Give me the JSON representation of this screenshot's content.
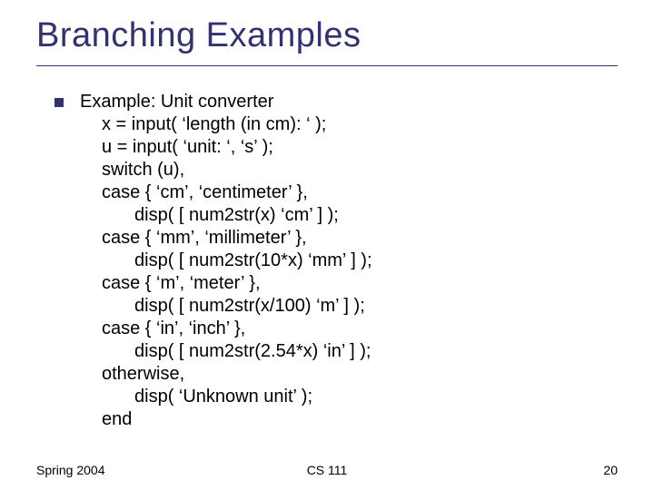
{
  "title": "Branching Examples",
  "bullet_label": "Example: Unit converter",
  "code": {
    "l01": "x = input( ‘length (in cm): ‘ );",
    "l02": "u = input( ‘unit: ‘, ‘s’ );",
    "l03": "switch (u),",
    "l04": "case { ‘cm’, ‘centimeter’ },",
    "l05": "disp( [ num2str(x) ‘cm’ ] );",
    "l06": "case { ‘mm’, ‘millimeter’ },",
    "l07": "disp( [ num2str(10*x) ‘mm’ ] );",
    "l08": "case { ‘m’, ‘meter’ },",
    "l09": "disp( [ num2str(x/100) ‘m’ ] );",
    "l10": "case { ‘in’, ‘inch’ },",
    "l11": "disp( [ num2str(2.54*x) ‘in’ ] );",
    "l12": "otherwise,",
    "l13": "disp( ‘Unknown unit’ );",
    "l14": "end"
  },
  "footer": {
    "left": "Spring 2004",
    "center": "CS 111",
    "right": "20"
  }
}
